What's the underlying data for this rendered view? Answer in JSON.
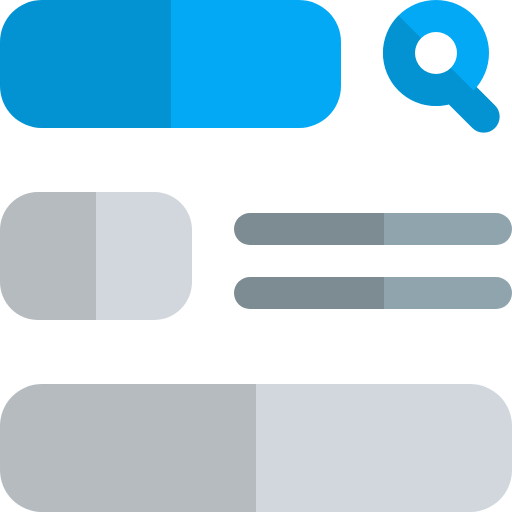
{
  "icon": {
    "name": "search-list-icon"
  },
  "colors": {
    "blue_dark": "#0392D2",
    "blue_light": "#03A9F4",
    "gray_block_dark": "#B5BBBE",
    "gray_block_light": "#D1D7DC",
    "gray_line_dark": "#7C8C92",
    "gray_line_light": "#90A4AE",
    "background": "#FFFFFF"
  }
}
